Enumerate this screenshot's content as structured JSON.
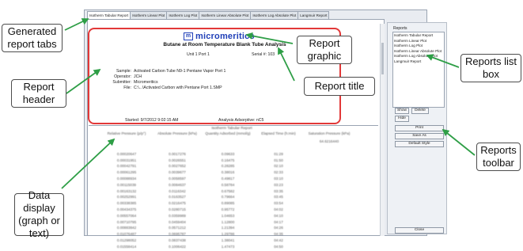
{
  "tabs": [
    {
      "label": "Isotherm Tabular Report",
      "active": true
    },
    {
      "label": "Isotherm Linear Plot"
    },
    {
      "label": "Isotherm Log Plot"
    },
    {
      "label": "Isotherm Linear Absolute Plot"
    },
    {
      "label": "Isotherm Log Absolute Plot"
    },
    {
      "label": "Langmuir Report"
    }
  ],
  "report": {
    "logo_text": "micromeritics",
    "logo_mark": "m",
    "title": "Butane at Room Temperature Blank Tube Analysis",
    "unit_label": "Unit 1 Port 1",
    "serial_label": "Serial #: 103",
    "fields": [
      {
        "key": "Sample:",
        "value": "Activated Carbon Tube N9-1 Pentane Vapor Port 1"
      },
      {
        "key": "Operator:",
        "value": "JCH"
      },
      {
        "key": "Submitter:",
        "value": "Micromeritics"
      },
      {
        "key": "File:",
        "value": "C:\\...\\Activated Carbon with Pentane Port 1.SMP"
      }
    ],
    "started": "Started: 9/7/2012 9:02:15 AM",
    "analysis_adsorptive": "Analysis Adsorptive: nC5"
  },
  "table": {
    "title": "Isotherm Tabular Report",
    "columns": [
      "Relative Pressure (p/p°)",
      "Absolute Pressure (kPa)",
      "Quantity Adsorbed (mmol/g)",
      "Elapsed Time (h:min)",
      "Saturation Pressure (kPa)"
    ],
    "sat_pressure": "64.6216440",
    "rows": [
      [
        "0.00020647",
        "0.0017276",
        "0.09633",
        "01:29"
      ],
      [
        "0.00031951",
        "0.0026551",
        "0.16475",
        "01:50"
      ],
      [
        "0.00042791",
        "0.0027652",
        "0.28285",
        "02:10"
      ],
      [
        "0.00061295",
        "0.0039677",
        "0.38016",
        "02:33"
      ],
      [
        "0.00088934",
        "0.0058597",
        "0.49817",
        "03:10"
      ],
      [
        "0.00115039",
        "0.0084637",
        "0.58784",
        "03:23"
      ],
      [
        "0.00163132",
        "0.0116342",
        "0.67582",
        "03:35"
      ],
      [
        "0.00252991",
        "0.0163527",
        "0.79664",
        "03:45"
      ],
      [
        "0.00338385",
        "0.0216475",
        "0.89085",
        "03:54"
      ],
      [
        "0.00434375",
        "0.0280715",
        "0.95772",
        "04:02"
      ],
      [
        "0.00557064",
        "0.0359989",
        "1.04653",
        "04:10"
      ],
      [
        "0.00710795",
        "0.0459404",
        "1.12800",
        "04:17"
      ],
      [
        "0.00883842",
        "0.0571212",
        "1.21394",
        "04:26"
      ],
      [
        "0.01076487",
        "0.0695787",
        "1.29786",
        "04:35"
      ],
      [
        "0.01298052",
        "0.0837438",
        "1.38041",
        "04:42"
      ],
      [
        "0.01558414",
        "0.1006422",
        "1.47473",
        "04:50"
      ]
    ]
  },
  "panel": {
    "label": "Reports",
    "list": [
      "Isotherm Tabular Report",
      "Isotherm Linear Plot",
      "Isotherm Log Plot",
      "Isotherm Linear Absolute Plot",
      "Isotherm Log Absolute Plot",
      "Langmuir Report"
    ],
    "show": "Show",
    "delete": "Delete",
    "hide": "Hide",
    "print": "Print",
    "save_as": "Save As",
    "default_style": "Default Style",
    "close": "Close"
  },
  "callouts": {
    "generated_tabs": "Generated report tabs",
    "report_header": "Report header",
    "data_display": "Data display (graph or text)",
    "report_graphic": "Report graphic",
    "report_title": "Report title",
    "reports_list_box": "Reports list box",
    "reports_toolbar": "Reports toolbar"
  },
  "colors": {
    "arrow": "#2e9e46",
    "highlight": "#e23838",
    "brand": "#1f3fb8"
  }
}
